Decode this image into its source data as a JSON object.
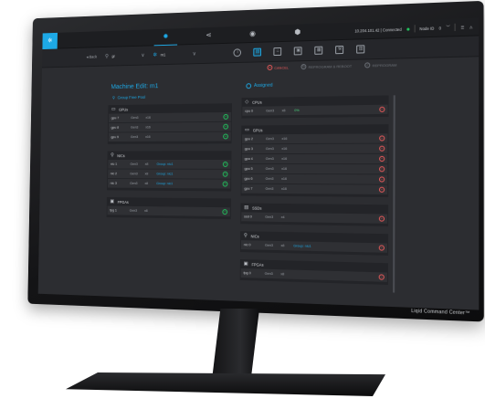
{
  "brand_text": "Liqid Command Center™",
  "topbar": {
    "status_text": "10.204.101.42 | Connected",
    "node_label": "Node ID",
    "node_value": "0",
    "nav": [
      {
        "icon": "cluster-icon"
      },
      {
        "icon": "share-icon"
      },
      {
        "icon": "camera-icon"
      },
      {
        "icon": "database-icon"
      }
    ]
  },
  "subbar": {
    "back_label": "Back",
    "group_crumb": "gr",
    "machine_crumb": "m1"
  },
  "actions": {
    "cancel": "CANCEL",
    "reprogram": "REPROGRAM & REBOOT",
    "reprogram_only": "REPROGRAM"
  },
  "page": {
    "title": "Machine Edit: m1",
    "group_free_pool": "Group Free Pool",
    "assigned": "Assigned"
  },
  "left_panels": [
    {
      "title": "GPUs",
      "icon": "gpu-icon",
      "rows": [
        {
          "id": "gpu 7",
          "a": "Gen3",
          "b": "x16",
          "c": ""
        },
        {
          "id": "gpu 8",
          "a": "Gen3",
          "b": "x16",
          "c": ""
        },
        {
          "id": "gpu 9",
          "a": "Gen3",
          "b": "x16",
          "c": ""
        }
      ]
    },
    {
      "title": "NICs",
      "icon": "network-icon",
      "rows": [
        {
          "id": "nic 1",
          "a": "Gen3",
          "b": "x8",
          "c": "Group: nic1"
        },
        {
          "id": "nic 2",
          "a": "Gen3",
          "b": "x8",
          "c": "Group: nic1"
        },
        {
          "id": "nic 3",
          "a": "Gen3",
          "b": "x8",
          "c": "Group: nic1"
        }
      ]
    },
    {
      "title": "FPGAs",
      "icon": "fpga-icon",
      "rows": [
        {
          "id": "fpg 1",
          "a": "Gen3",
          "b": "x8",
          "c": ""
        }
      ]
    }
  ],
  "right_panels": [
    {
      "title": "CPUs",
      "icon": "cpu-icon",
      "rows": [
        {
          "id": "cpu 0",
          "a": "Gen3",
          "b": "x8",
          "c": "0%"
        }
      ]
    },
    {
      "title": "GPUs",
      "icon": "gpu-icon",
      "rows": [
        {
          "id": "gpu 2",
          "a": "Gen3",
          "b": "x16",
          "c": ""
        },
        {
          "id": "gpu 3",
          "a": "Gen3",
          "b": "x16",
          "c": ""
        },
        {
          "id": "gpu 4",
          "a": "Gen3",
          "b": "x16",
          "c": ""
        },
        {
          "id": "gpu 5",
          "a": "Gen3",
          "b": "x16",
          "c": ""
        },
        {
          "id": "gpu 6",
          "a": "Gen3",
          "b": "x16",
          "c": ""
        },
        {
          "id": "gpu 7",
          "a": "Gen3",
          "b": "x16",
          "c": ""
        }
      ]
    },
    {
      "title": "SSDs",
      "icon": "ssd-icon",
      "rows": [
        {
          "id": "ssd 0",
          "a": "Gen3",
          "b": "x4",
          "c": ""
        }
      ]
    },
    {
      "title": "NICs",
      "icon": "network-icon",
      "rows": [
        {
          "id": "nic 0",
          "a": "Gen3",
          "b": "x8",
          "c": "Group: nic1"
        }
      ]
    },
    {
      "title": "FPGAs",
      "icon": "fpga-icon",
      "rows": [
        {
          "id": "fpg 0",
          "a": "Gen3",
          "b": "x8",
          "c": ""
        }
      ]
    }
  ],
  "colors": {
    "accent": "#1da9e6",
    "add": "#22c55e",
    "remove": "#e85a5a"
  }
}
